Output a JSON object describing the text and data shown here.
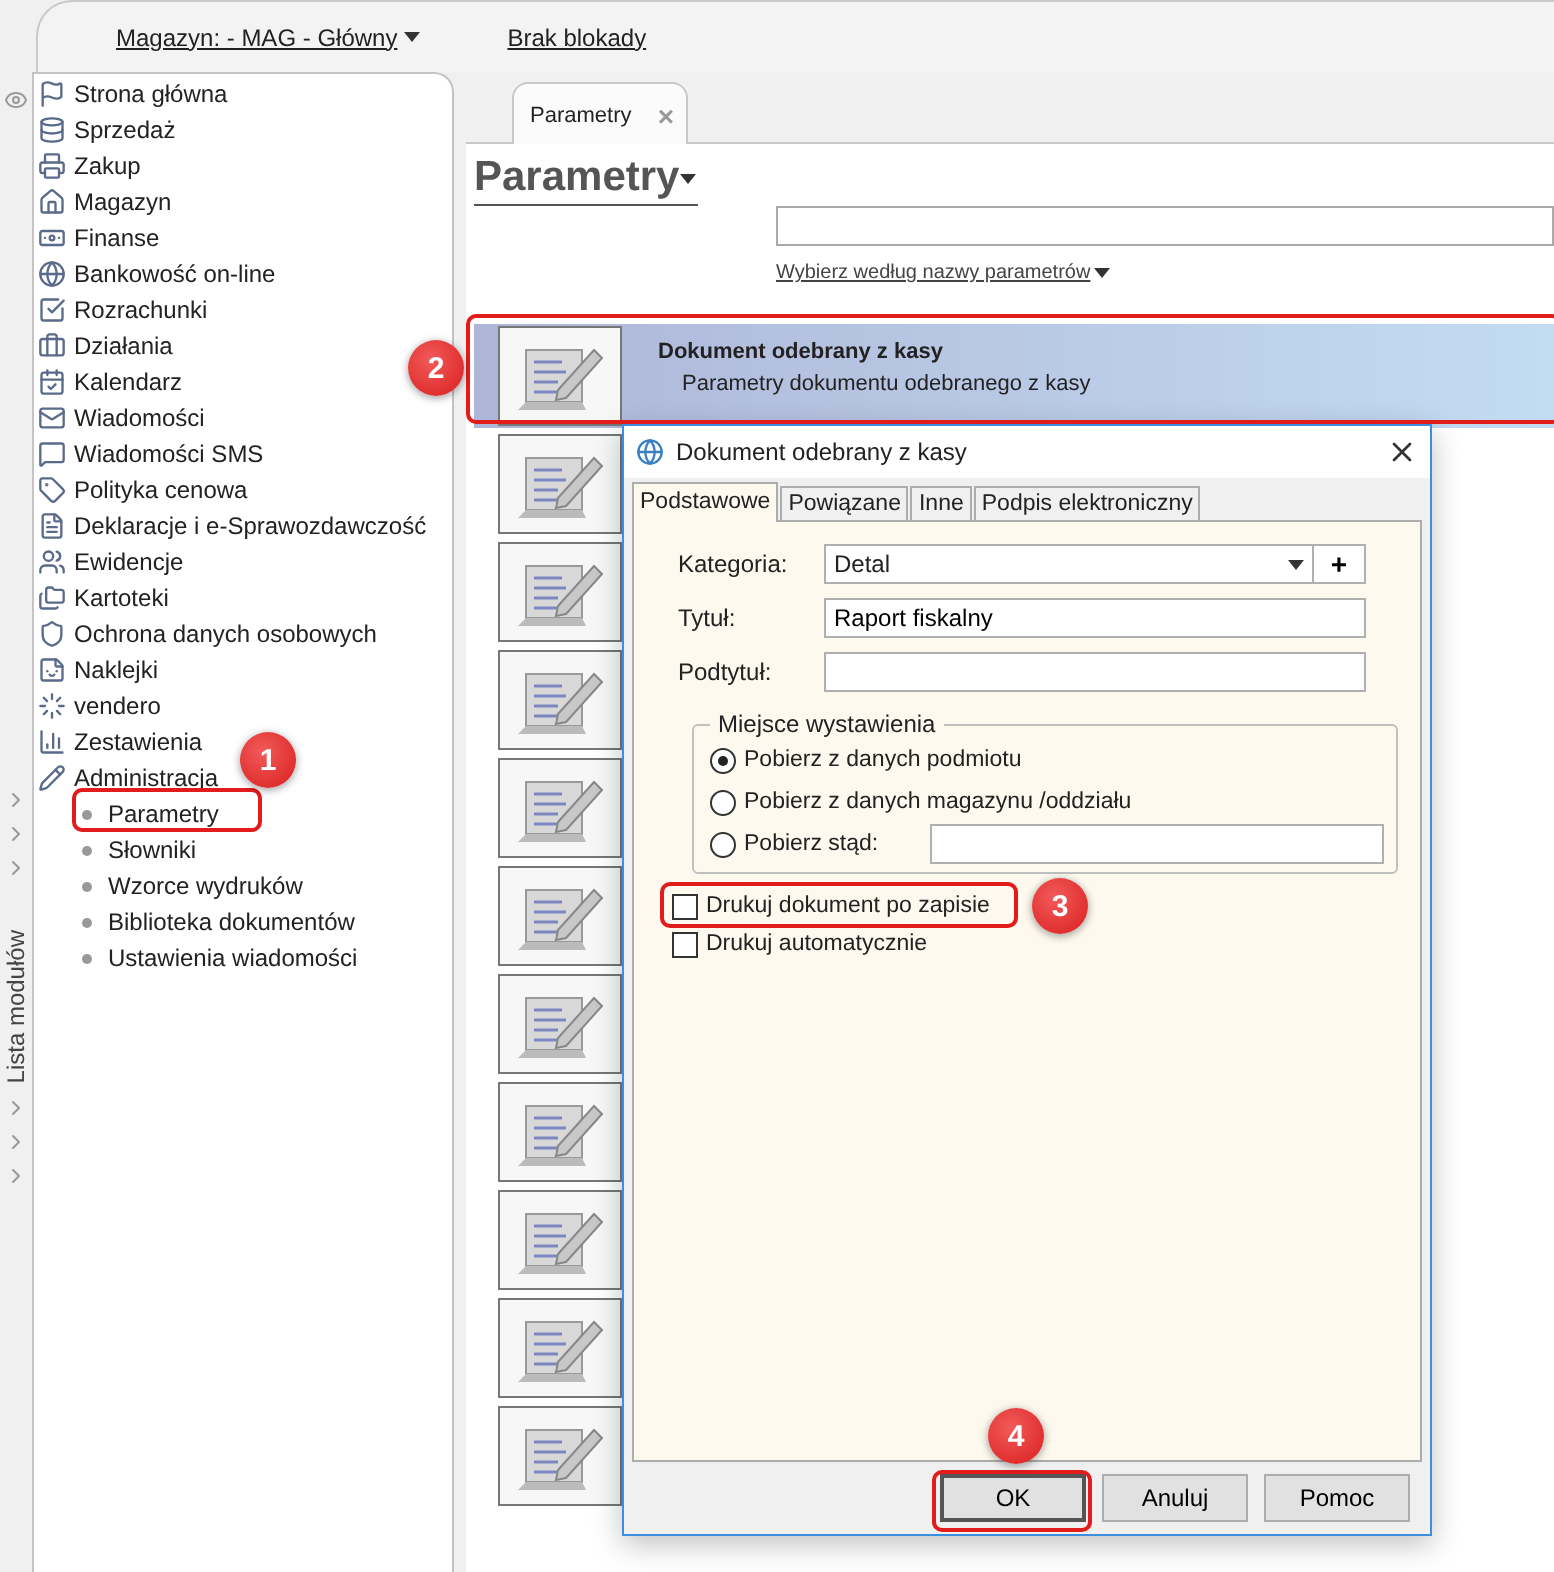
{
  "top_bar": {
    "warehouse": "Magazyn: - MAG - Główny",
    "lock_status": "Brak blokady"
  },
  "module_strip": {
    "label": "Lista modułów"
  },
  "sidebar": {
    "items": [
      {
        "label": "Strona główna"
      },
      {
        "label": "Sprzedaż"
      },
      {
        "label": "Zakup"
      },
      {
        "label": "Magazyn"
      },
      {
        "label": "Finanse"
      },
      {
        "label": "Bankowość on-line"
      },
      {
        "label": "Rozrachunki"
      },
      {
        "label": "Działania"
      },
      {
        "label": "Kalendarz"
      },
      {
        "label": "Wiadomości"
      },
      {
        "label": "Wiadomości SMS"
      },
      {
        "label": "Polityka cenowa"
      },
      {
        "label": "Deklaracje i e-Sprawozdawczość"
      },
      {
        "label": "Ewidencje"
      },
      {
        "label": "Kartoteki"
      },
      {
        "label": "Ochrona danych osobowych"
      },
      {
        "label": "Naklejki"
      },
      {
        "label": "vendero"
      },
      {
        "label": "Zestawienia"
      },
      {
        "label": "Administracja",
        "children": [
          {
            "label": "Parametry"
          },
          {
            "label": "Słowniki"
          },
          {
            "label": "Wzorce wydruków"
          },
          {
            "label": "Biblioteka dokumentów"
          },
          {
            "label": "Ustawienia wiadomości"
          }
        ]
      }
    ]
  },
  "tabs": [
    {
      "label": "Parametry",
      "selected": true,
      "close": "×"
    }
  ],
  "page": {
    "title": "Parametry",
    "filter_link": "Wybierz według nazwy parametrów"
  },
  "rows": [
    {
      "title": "Dokument odebrany z kasy",
      "description": "Parametry dokumentu odebranego z kasy",
      "selected": true
    },
    {
      "selected": false
    },
    {
      "selected": false
    },
    {
      "selected": false
    },
    {
      "selected": false
    },
    {
      "selected": false
    },
    {
      "selected": false
    },
    {
      "selected": false
    },
    {
      "selected": false
    },
    {
      "selected": false
    },
    {
      "selected": false
    }
  ],
  "dialog": {
    "title": "Dokument odebrany z kasy",
    "tabs": [
      {
        "label": "Podstawowe",
        "selected": true
      },
      {
        "label": "Powiązane",
        "selected": false
      },
      {
        "label": "Inne",
        "selected": false
      },
      {
        "label": "Podpis elektroniczny",
        "selected": false
      }
    ],
    "fields": [
      {
        "kind": "select",
        "label": "Kategoria:",
        "value": "Detal",
        "add": "+"
      },
      {
        "kind": "text",
        "label": "Tytuł:",
        "value": "Raport fiskalny"
      },
      {
        "kind": "text",
        "label": "Podtytuł:"
      }
    ],
    "group": {
      "title": "Miejsce wystawienia",
      "options": [
        {
          "label": "Pobierz z danych podmiotu",
          "selected": true
        },
        {
          "label": "Pobierz z danych magazynu /oddziału",
          "selected": false
        },
        {
          "label": "Pobierz stąd:",
          "selected": false,
          "kind": "with_input"
        }
      ]
    },
    "checkboxes": [
      {
        "label": "Drukuj dokument po zapisie",
        "checked": false
      },
      {
        "label": "Drukuj automatycznie",
        "checked": false
      }
    ],
    "buttons": [
      {
        "label": "OK",
        "default": true
      },
      {
        "label": "Anuluj",
        "default": false
      },
      {
        "label": "Pomoc",
        "default": false
      }
    ]
  },
  "callouts": [
    {
      "label": "1"
    },
    {
      "label": "2"
    },
    {
      "label": "3"
    },
    {
      "label": "4"
    }
  ]
}
